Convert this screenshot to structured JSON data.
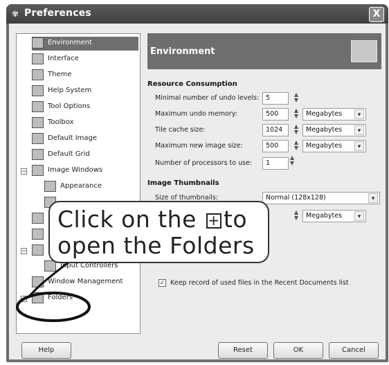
{
  "window": {
    "title": "Preferences",
    "close_glyph": "X"
  },
  "sidebar": {
    "items": [
      {
        "label": "Environment",
        "icon": "environment-icon"
      },
      {
        "label": "Interface",
        "icon": "interface-icon"
      },
      {
        "label": "Theme",
        "icon": "theme-icon"
      },
      {
        "label": "Help System",
        "icon": "help-system-icon"
      },
      {
        "label": "Tool Options",
        "icon": "tool-options-icon"
      },
      {
        "label": "Toolbox",
        "icon": "toolbox-icon"
      },
      {
        "label": "Default Image",
        "icon": "default-image-icon"
      },
      {
        "label": "Default Grid",
        "icon": "default-grid-icon"
      },
      {
        "label": "Image Windows",
        "icon": "image-windows-icon"
      },
      {
        "label": "Appearance",
        "icon": "appearance-icon"
      },
      {
        "label": "Input Controllers",
        "icon": "input-controllers-icon"
      },
      {
        "label": "Window Management",
        "icon": "window-management-icon"
      },
      {
        "label": "Folders",
        "icon": "folders-icon"
      }
    ],
    "expander_minus": "−",
    "expander_plus": "+"
  },
  "panel": {
    "title": "Environment",
    "resource_section": "Resource Consumption",
    "rows": [
      {
        "label": "Minimal number of undo levels:",
        "value": "5",
        "unit": ""
      },
      {
        "label": "Maximum undo memory:",
        "value": "500",
        "unit": "Megabytes"
      },
      {
        "label": "Tile cache size:",
        "value": "1024",
        "unit": "Megabytes"
      },
      {
        "label": "Maximum new image size:",
        "value": "500",
        "unit": "Megabytes"
      },
      {
        "label": "Number of processors to use:",
        "value": "1",
        "unit": ""
      }
    ],
    "thumb_section": "Image Thumbnails",
    "thumb_size_label": "Size of thumbnails:",
    "thumb_size_value": "Normal (128x128)",
    "thumb_unit": "Megabytes",
    "recent_label": "Keep record of used files in the Recent Documents list",
    "recent_checked": true
  },
  "buttons": {
    "help": "Help",
    "reset": "Reset",
    "ok": "OK",
    "cancel": "Cancel"
  },
  "callout": {
    "line1_pre": "Click on the",
    "plus_glyph": "+",
    "line1_post": "to",
    "line2": "open the Folders"
  },
  "colors": {
    "titlebar": "#4a4a4a",
    "selection": "#6f6f6f",
    "annotation": "#111111"
  }
}
